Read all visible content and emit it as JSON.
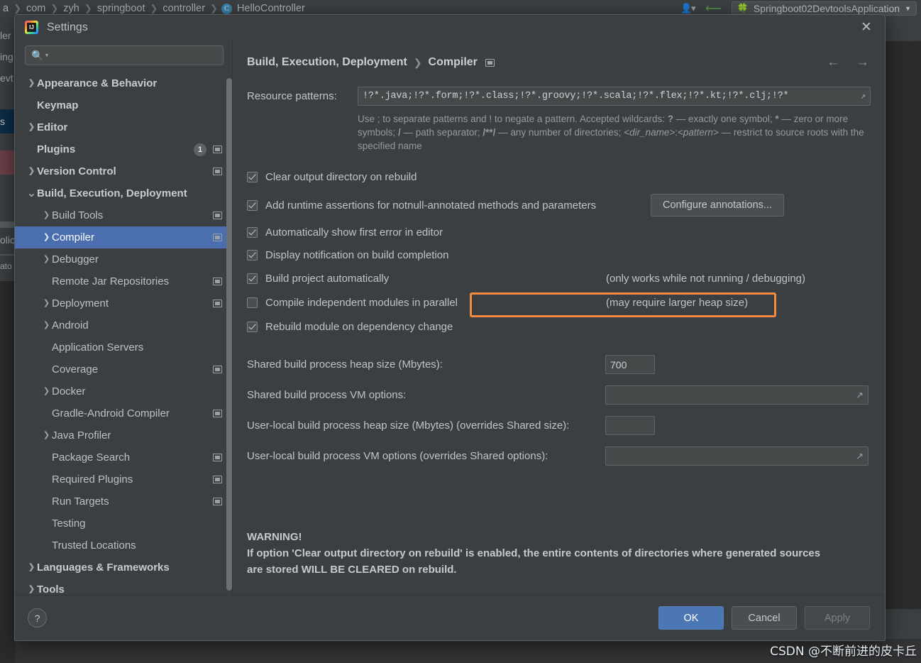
{
  "ide": {
    "breadcrumb": [
      "a",
      "com",
      "zyh",
      "springboot",
      "controller"
    ],
    "class_name": "HelloController",
    "class_badge": "C",
    "run_config": "Springboot02DevtoolsApplication",
    "sliver_texts": [
      "ler",
      "ing",
      "evt",
      "s",
      "olic",
      "ato"
    ]
  },
  "dialog": {
    "title": "Settings",
    "close_label": "✕"
  },
  "search": {
    "value": "",
    "placeholder": ""
  },
  "tree": {
    "items": [
      {
        "label": "Appearance & Behavior",
        "arrow": "right",
        "bold": true,
        "indent": 0,
        "proj": false,
        "badge": null
      },
      {
        "label": "Keymap",
        "arrow": "none",
        "bold": true,
        "indent": 0,
        "proj": false,
        "badge": null
      },
      {
        "label": "Editor",
        "arrow": "right",
        "bold": true,
        "indent": 0,
        "proj": false,
        "badge": null
      },
      {
        "label": "Plugins",
        "arrow": "none",
        "bold": true,
        "indent": 0,
        "proj": true,
        "badge": "1"
      },
      {
        "label": "Version Control",
        "arrow": "right",
        "bold": true,
        "indent": 0,
        "proj": true,
        "badge": null
      },
      {
        "label": "Build, Execution, Deployment",
        "arrow": "down",
        "bold": true,
        "indent": 0,
        "proj": false,
        "badge": null
      },
      {
        "label": "Build Tools",
        "arrow": "right",
        "bold": false,
        "indent": 1,
        "proj": true,
        "badge": null
      },
      {
        "label": "Compiler",
        "arrow": "right",
        "bold": false,
        "indent": 1,
        "proj": true,
        "badge": null,
        "selected": true
      },
      {
        "label": "Debugger",
        "arrow": "right",
        "bold": false,
        "indent": 1,
        "proj": false,
        "badge": null
      },
      {
        "label": "Remote Jar Repositories",
        "arrow": "none",
        "bold": false,
        "indent": 1,
        "proj": true,
        "badge": null
      },
      {
        "label": "Deployment",
        "arrow": "right",
        "bold": false,
        "indent": 1,
        "proj": true,
        "badge": null
      },
      {
        "label": "Android",
        "arrow": "right",
        "bold": false,
        "indent": 1,
        "proj": false,
        "badge": null
      },
      {
        "label": "Application Servers",
        "arrow": "none",
        "bold": false,
        "indent": 1,
        "proj": false,
        "badge": null
      },
      {
        "label": "Coverage",
        "arrow": "none",
        "bold": false,
        "indent": 1,
        "proj": true,
        "badge": null
      },
      {
        "label": "Docker",
        "arrow": "right",
        "bold": false,
        "indent": 1,
        "proj": false,
        "badge": null
      },
      {
        "label": "Gradle-Android Compiler",
        "arrow": "none",
        "bold": false,
        "indent": 1,
        "proj": true,
        "badge": null
      },
      {
        "label": "Java Profiler",
        "arrow": "right",
        "bold": false,
        "indent": 1,
        "proj": false,
        "badge": null
      },
      {
        "label": "Package Search",
        "arrow": "none",
        "bold": false,
        "indent": 1,
        "proj": true,
        "badge": null
      },
      {
        "label": "Required Plugins",
        "arrow": "none",
        "bold": false,
        "indent": 1,
        "proj": true,
        "badge": null
      },
      {
        "label": "Run Targets",
        "arrow": "none",
        "bold": false,
        "indent": 1,
        "proj": true,
        "badge": null
      },
      {
        "label": "Testing",
        "arrow": "none",
        "bold": false,
        "indent": 1,
        "proj": false,
        "badge": null
      },
      {
        "label": "Trusted Locations",
        "arrow": "none",
        "bold": false,
        "indent": 1,
        "proj": false,
        "badge": null
      },
      {
        "label": "Languages & Frameworks",
        "arrow": "right",
        "bold": true,
        "indent": 0,
        "proj": false,
        "badge": null
      },
      {
        "label": "Tools",
        "arrow": "right",
        "bold": true,
        "indent": 0,
        "proj": false,
        "badge": null
      }
    ]
  },
  "content": {
    "breadcrumb_parent": "Build, Execution, Deployment",
    "breadcrumb_current": "Compiler",
    "resource_patterns_label": "Resource patterns:",
    "resource_patterns_value": "!?*.java;!?*.form;!?*.class;!?*.groovy;!?*.scala;!?*.flex;!?*.kt;!?*.clj;!?*",
    "help_text_1": "Use ; to separate patterns and ! to negate a pattern. Accepted wildcards: ",
    "help_wild_q": "?",
    "help_text_2": " — exactly one symbol; ",
    "help_wild_star": "*",
    "help_text_3": " — zero or more symbols; ",
    "help_wild_slash": "/",
    "help_text_4": " — path separator; ",
    "help_wild_dirs": "/**/",
    "help_text_5": " — any number of directories; ",
    "help_dir_name": "<dir_name>",
    "help_colon": ":",
    "help_pattern": "<pattern>",
    "help_text_6": " — restrict to source roots with the specified name",
    "checkboxes": [
      {
        "label": "Clear output directory on rebuild",
        "checked": true,
        "note": ""
      },
      {
        "label": "Add runtime assertions for notnull-annotated methods and parameters",
        "checked": true,
        "note": ""
      },
      {
        "label": "Automatically show first error in editor",
        "checked": true,
        "note": ""
      },
      {
        "label": "Display notification on build completion",
        "checked": true,
        "note": ""
      },
      {
        "label": "Build project automatically",
        "checked": true,
        "note": "(only works while not running / debugging)"
      },
      {
        "label": "Compile independent modules in parallel",
        "checked": false,
        "note": "(may require larger heap size)"
      },
      {
        "label": "Rebuild module on dependency change",
        "checked": true,
        "note": ""
      }
    ],
    "configure_annotations_label": "Configure annotations...",
    "fields": [
      {
        "label": "Shared build process heap size (Mbytes):",
        "value": "700",
        "wide": false,
        "expand": false
      },
      {
        "label": "Shared build process VM options:",
        "value": "",
        "wide": true,
        "expand": true
      },
      {
        "label": "User-local build process heap size (Mbytes) (overrides Shared size):",
        "value": "",
        "wide": false,
        "expand": false
      },
      {
        "label": "User-local build process VM options (overrides Shared options):",
        "value": "",
        "wide": true,
        "expand": true
      }
    ],
    "warning_title": "WARNING!",
    "warning_line1": "If option 'Clear output directory on rebuild' is enabled, the entire contents of directories where generated sources",
    "warning_line2": "are stored WILL BE CLEARED on rebuild."
  },
  "footer": {
    "help_label": "?",
    "ok_label": "OK",
    "cancel_label": "Cancel",
    "apply_label": "Apply"
  },
  "watermark": "CSDN @不断前进的皮卡丘",
  "colors": {
    "accent": "#4b77b5",
    "selection": "#4b6eaf",
    "highlight": "#f58b41",
    "panel": "#3c3f41"
  }
}
